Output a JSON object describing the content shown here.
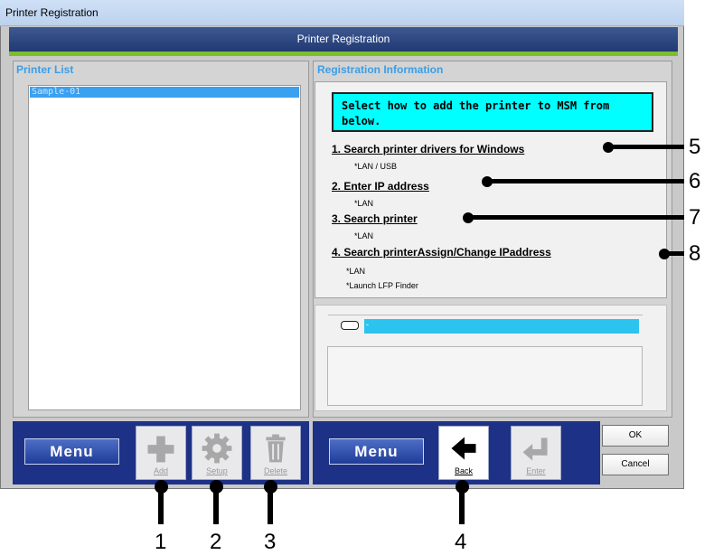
{
  "window": {
    "title": "Printer Registration",
    "banner_title": "Printer Registration"
  },
  "printer_list": {
    "title": "Printer List",
    "items": [
      "Sample-01"
    ]
  },
  "registration": {
    "title": "Registration Information",
    "instruction": "Select how to add the printer to MSM from below.",
    "options": [
      {
        "label": "1. Search printer drivers for Windows",
        "notes": [
          "*LAN / USB"
        ]
      },
      {
        "label": "2. Enter IP address",
        "notes": [
          "*LAN"
        ]
      },
      {
        "label": "3. Search printer",
        "notes": [
          "*LAN"
        ]
      },
      {
        "label": "4. Search printerAssign/Change IPaddress",
        "notes": [
          "*LAN",
          "*Launch LFP Finder"
        ]
      }
    ],
    "status_text": "-"
  },
  "toolbar_left": {
    "menu_label": "Menu",
    "add_label": "Add",
    "setup_label": "Setup",
    "delete_label": "Delete"
  },
  "toolbar_right": {
    "menu_label": "Menu",
    "back_label": "Back",
    "enter_label": "Enter",
    "ok_label": "OK",
    "cancel_label": "Cancel"
  },
  "callouts": {
    "n1": "1",
    "n2": "2",
    "n3": "3",
    "n4": "4",
    "n5": "5",
    "n6": "6",
    "n7": "7",
    "n8": "8"
  },
  "colors": {
    "banner": "#213a73",
    "accent_green": "#7dbf2a",
    "section_title": "#3a9ee8",
    "instruction_bg": "#00ffff",
    "status_bar": "#2dc3ef",
    "toolbar_bg": "#1d3186"
  },
  "icons": {
    "add": "plus-icon",
    "setup": "gear-icon",
    "delete": "trash-icon",
    "back": "arrow-left-icon",
    "enter": "enter-icon"
  }
}
